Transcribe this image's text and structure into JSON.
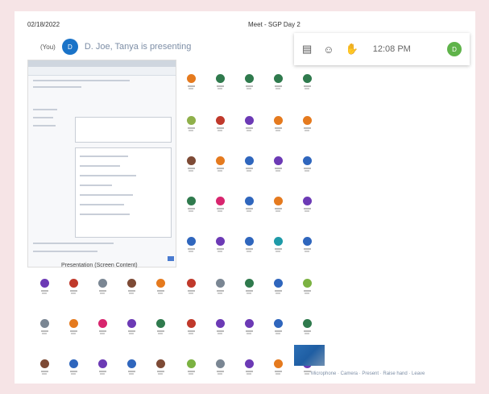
{
  "header": {
    "date": "02/18/2022",
    "meeting_title": "Meet - SGP Day 2"
  },
  "presenter": {
    "you_label": "(You)",
    "initial": "D",
    "text": "D. Joe, Tanya is presenting"
  },
  "toolbar": {
    "clock": "12:08 PM",
    "self_initial": "D",
    "icons": [
      "clipboard-icon",
      "people-icon",
      "hand-icon"
    ]
  },
  "screen_share": {
    "caption": "Presentation (Screen Content)"
  },
  "footer": {
    "caption": "Microphone · Camera · Present · Raise hand · Leave"
  },
  "colors": {
    "blue": "#2f66bd",
    "green": "#2f7a4d",
    "orange": "#e57a1e",
    "violet": "#6c3ab5",
    "magenta": "#d8256e",
    "gray": "#7a8693",
    "red": "#c0392b",
    "olive": "#8fb04a",
    "teal": "#1e9aa8",
    "brown": "#7d4a35",
    "lime": "#7bb241"
  },
  "participant_colors": [
    "orange",
    "green",
    "green",
    "green",
    "green",
    "olive",
    "red",
    "violet",
    "orange",
    "orange",
    "brown",
    "orange",
    "blue",
    "violet",
    "blue",
    "green",
    "magenta",
    "blue",
    "orange",
    "violet",
    "blue",
    "violet",
    "blue",
    "teal",
    "blue",
    "violet",
    "red",
    "gray",
    "brown",
    "orange",
    "red",
    "gray",
    "green",
    "blue",
    "lime",
    "gray",
    "orange",
    "magenta",
    "violet",
    "green",
    "red",
    "violet",
    "violet",
    "blue",
    "green",
    "brown",
    "blue",
    "violet",
    "blue",
    "brown",
    "lime",
    "gray",
    "violet",
    "orange",
    "violet"
  ]
}
